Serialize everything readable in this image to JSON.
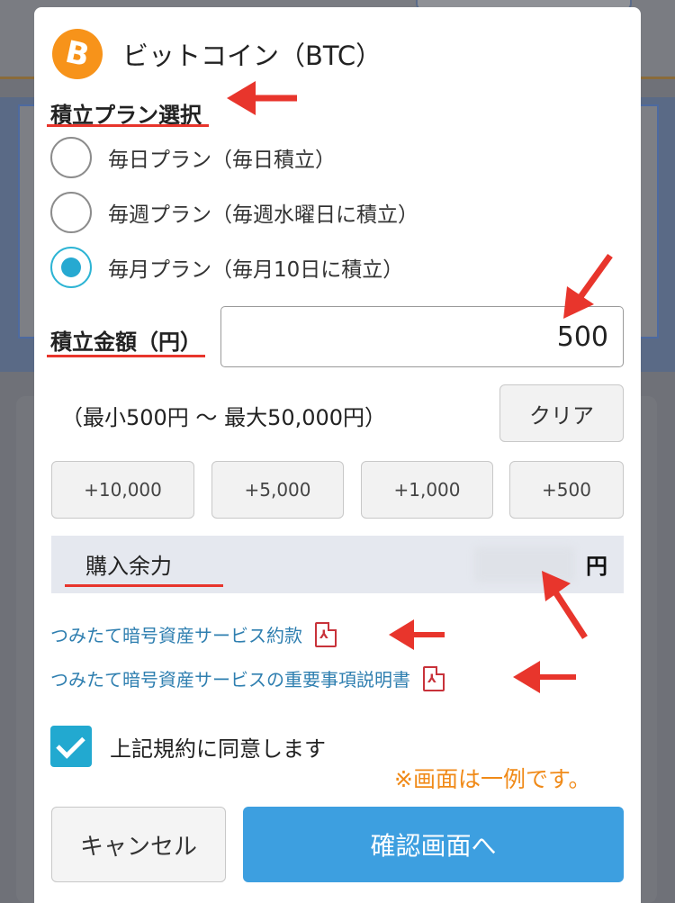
{
  "header": {
    "logo_symbol": "B",
    "title": "ビットコイン（BTC）"
  },
  "plan": {
    "label": "積立プラン選択",
    "options": [
      {
        "label": "毎日プラン（毎日積立）",
        "selected": false
      },
      {
        "label": "毎週プラン（毎週水曜日に積立）",
        "selected": false
      },
      {
        "label": "毎月プラン（毎月10日に積立）",
        "selected": true
      }
    ]
  },
  "amount": {
    "label": "積立金額（円）",
    "value": "500",
    "range": "（最小500円 〜 最大50,000円）",
    "clear_label": "クリア",
    "increments": [
      "+10,000",
      "+5,000",
      "+1,000",
      "+500"
    ]
  },
  "balance": {
    "label": "購入余力",
    "unit": "円"
  },
  "links": [
    {
      "label": "つみたて暗号資産サービス約款"
    },
    {
      "label": "つみたて暗号資産サービスの重要事項説明書"
    }
  ],
  "pdf_icon_text": "⅄",
  "agree": {
    "label": "上記規約に同意します",
    "checked": true
  },
  "note": "※画面は一例です。",
  "footer": {
    "cancel_label": "キャンセル",
    "confirm_label": "確認画面へ"
  },
  "colors": {
    "accent": "#22a9d0",
    "confirm": "#3d9fe0",
    "annotation": "#e8352c",
    "note": "#f08a18",
    "bitcoin": "#f7931a"
  }
}
